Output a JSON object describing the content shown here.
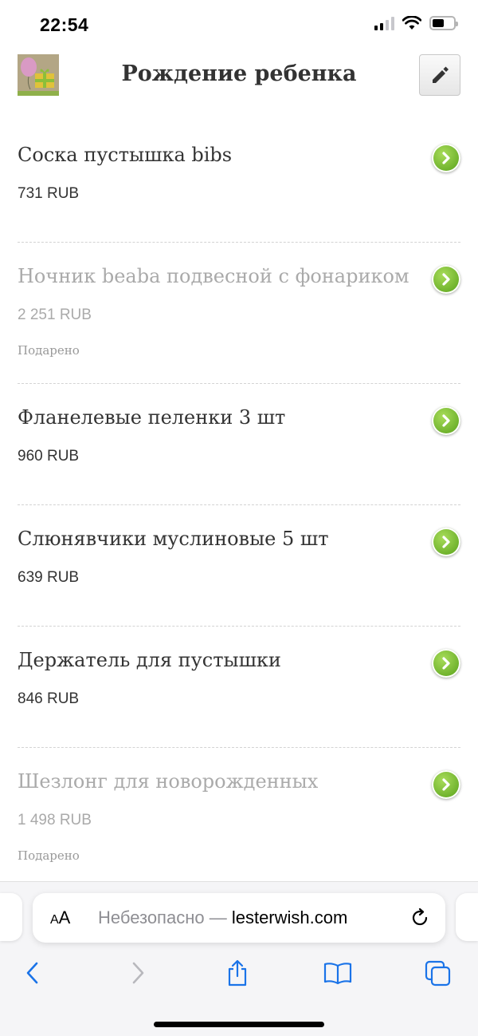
{
  "status_bar": {
    "time": "22:54"
  },
  "header": {
    "title": "Рождение ребенка"
  },
  "items": [
    {
      "title": "Соска пустышка bibs",
      "price": "731 RUB",
      "status": ""
    },
    {
      "title": "Ночник beaba подвесной с фонариком",
      "price": "2 251 RUB",
      "status": "Подарено"
    },
    {
      "title": "Фланелевые пеленки 3 шт",
      "price": "960 RUB",
      "status": ""
    },
    {
      "title": "Слюнявчики муслиновые 5 шт",
      "price": "639 RUB",
      "status": ""
    },
    {
      "title": "Держатель для пустышки",
      "price": "846 RUB",
      "status": ""
    },
    {
      "title": "Шезлонг для новорожденных",
      "price": "1 498 RUB",
      "status": "Подарено"
    }
  ],
  "browser": {
    "text_size_button": "AA",
    "url_prefix": "Небезопасно — ",
    "url_domain": "lesterwish.com"
  },
  "colors": {
    "accent_green": "#7dc13a",
    "gifted_text": "#aaaaaa",
    "text": "#333333"
  },
  "icons": {
    "edit": "pencil-icon",
    "go": "chevron-right-icon",
    "back": "chevron-left-icon",
    "forward": "chevron-right-icon",
    "share": "share-icon",
    "bookmarks": "book-icon",
    "tabs": "tabs-icon",
    "reload": "reload-icon"
  }
}
